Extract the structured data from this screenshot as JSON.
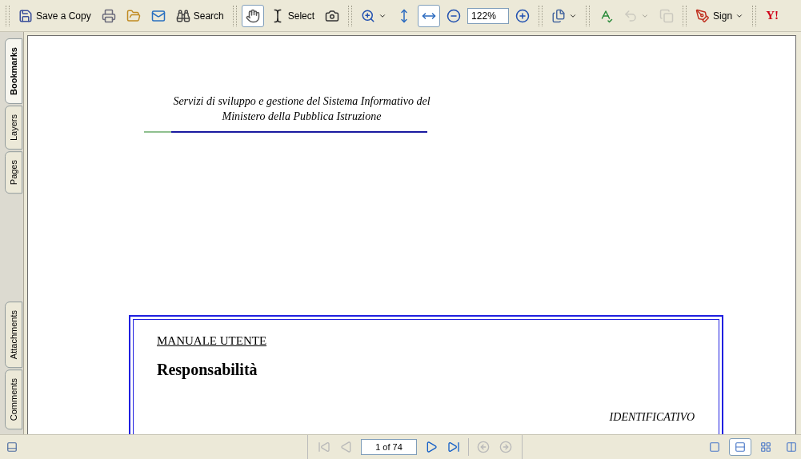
{
  "toolbar": {
    "items": [
      {
        "kind": "grip"
      },
      {
        "kind": "button",
        "label": "Save a Copy",
        "disabled": false
      },
      {
        "kind": "button",
        "disabled": false
      },
      {
        "kind": "button",
        "disabled": false
      },
      {
        "kind": "button",
        "disabled": false
      },
      {
        "kind": "button",
        "label": "Search",
        "disabled": false
      },
      {
        "kind": "grip"
      },
      {
        "kind": "tool",
        "selected": true
      },
      {
        "kind": "tool",
        "label": "Select",
        "selected": false
      },
      {
        "kind": "tool",
        "selected": false
      },
      {
        "kind": "grip"
      },
      {
        "kind": "button",
        "disabled": false
      },
      {
        "kind": "tool",
        "selected": false
      },
      {
        "kind": "tool",
        "selected": true
      },
      {
        "kind": "button",
        "disabled": false
      },
      {
        "kind": "zoom",
        "value": "122%"
      },
      {
        "kind": "button",
        "disabled": false
      },
      {
        "kind": "grip"
      },
      {
        "kind": "button",
        "disabled": false
      },
      {
        "kind": "grip"
      },
      {
        "kind": "button",
        "disabled": false
      },
      {
        "kind": "button",
        "disabled": true
      },
      {
        "kind": "button",
        "disabled": true
      },
      {
        "kind": "grip"
      },
      {
        "kind": "button",
        "label": "Sign",
        "disabled": false
      },
      {
        "kind": "grip"
      },
      {
        "kind": "logo",
        "text": "Y!"
      }
    ]
  },
  "side_tabs": {
    "top": [
      {
        "label": "Bookmarks",
        "selected": true
      },
      {
        "label": "Layers",
        "selected": false
      },
      {
        "label": "Pages",
        "selected": false
      }
    ],
    "bottom": [
      {
        "label": "Attachments",
        "selected": false
      },
      {
        "label": "Comments",
        "selected": false
      }
    ]
  },
  "document": {
    "header": [
      "Servizi di sviluppo e gestione del Sistema Informativo del",
      "Ministero della Pubblica Istruzione"
    ],
    "section": "MANUALE UTENTE",
    "title": "Responsabilità",
    "label": "IDENTIFICATIVO"
  },
  "status_bar": {
    "navigation": [
      {
        "kind": "button",
        "disabled": true
      },
      {
        "kind": "button",
        "disabled": true
      },
      {
        "kind": "page",
        "value": "1 of 74"
      },
      {
        "kind": "button",
        "disabled": false
      },
      {
        "kind": "button",
        "disabled": false
      },
      {
        "kind": "button",
        "disabled": true
      },
      {
        "kind": "button",
        "disabled": true
      }
    ],
    "layouts": [
      {
        "selected": false
      },
      {
        "selected": true
      },
      {
        "selected": false
      },
      {
        "selected": false
      }
    ]
  }
}
